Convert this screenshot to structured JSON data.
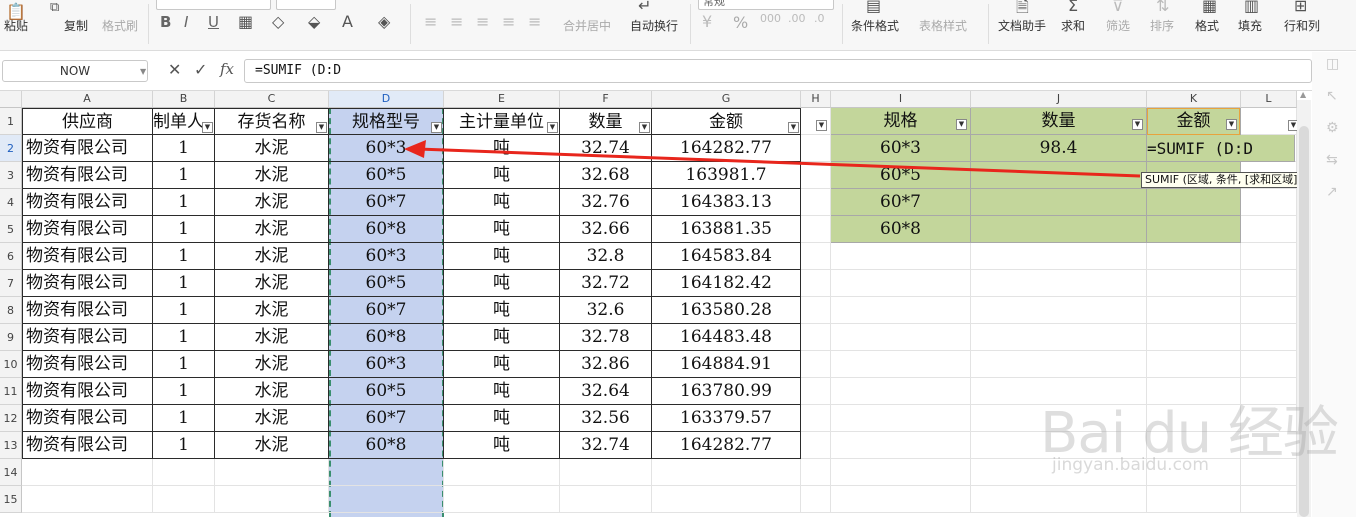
{
  "ribbon": {
    "paste": "粘贴",
    "copy": "复制",
    "format_painter": "格式刷",
    "bold": "B",
    "italic": "I",
    "underline": "U",
    "merge_center": "合并居中",
    "wrap_text": "自动换行",
    "number_format": "常规",
    "percent": "%",
    "conditional_format": "条件格式",
    "table_style": "表格样式",
    "doc_assistant": "文档助手",
    "sum": "求和",
    "filter": "筛选",
    "sort": "排序",
    "format": "格式",
    "fill": "填充",
    "row_col": "行和列",
    "accent": "#e8a33d"
  },
  "formula_bar": {
    "name_box": "NOW",
    "cancel": "✕",
    "confirm": "✓",
    "fx": "fx",
    "formula": "=SUMIF (D:D"
  },
  "columns": [
    "A",
    "B",
    "C",
    "D",
    "E",
    "F",
    "G",
    "H",
    "I",
    "J",
    "K",
    "L"
  ],
  "rows": [
    "1",
    "2",
    "3",
    "4",
    "5",
    "6",
    "7",
    "8",
    "9",
    "10",
    "11",
    "12",
    "13",
    "14",
    "15"
  ],
  "table": {
    "headers": [
      "供应商",
      "制单人",
      "存货名称",
      "规格型号",
      "主计量单位",
      "数量",
      "金额"
    ],
    "rows": [
      [
        "物资有限公司",
        "1",
        "水泥",
        "60*3",
        "吨",
        "32.74",
        "164282.77"
      ],
      [
        "物资有限公司",
        "1",
        "水泥",
        "60*5",
        "吨",
        "32.68",
        "163981.7"
      ],
      [
        "物资有限公司",
        "1",
        "水泥",
        "60*7",
        "吨",
        "32.76",
        "164383.13"
      ],
      [
        "物资有限公司",
        "1",
        "水泥",
        "60*8",
        "吨",
        "32.66",
        "163881.35"
      ],
      [
        "物资有限公司",
        "1",
        "水泥",
        "60*3",
        "吨",
        "32.8",
        "164583.84"
      ],
      [
        "物资有限公司",
        "1",
        "水泥",
        "60*5",
        "吨",
        "32.72",
        "164182.42"
      ],
      [
        "物资有限公司",
        "1",
        "水泥",
        "60*7",
        "吨",
        "32.6",
        "163580.28"
      ],
      [
        "物资有限公司",
        "1",
        "水泥",
        "60*8",
        "吨",
        "32.78",
        "164483.48"
      ],
      [
        "物资有限公司",
        "1",
        "水泥",
        "60*3",
        "吨",
        "32.86",
        "164884.91"
      ],
      [
        "物资有限公司",
        "1",
        "水泥",
        "60*5",
        "吨",
        "32.64",
        "163780.99"
      ],
      [
        "物资有限公司",
        "1",
        "水泥",
        "60*7",
        "吨",
        "32.56",
        "163379.57"
      ],
      [
        "物资有限公司",
        "1",
        "水泥",
        "60*8",
        "吨",
        "32.74",
        "164282.77"
      ]
    ]
  },
  "summary": {
    "headers": [
      "规格",
      "数量",
      "金额"
    ],
    "rows": [
      [
        "60*3",
        "98.4",
        "=SUMIF (D:D"
      ],
      [
        "60*5",
        "",
        ""
      ],
      [
        "60*7",
        "",
        ""
      ],
      [
        "60*8",
        "",
        ""
      ]
    ],
    "fill_color": "#c3d69b"
  },
  "tooltip": "SUMIF (区域, 条件, [求和区域])",
  "watermark": {
    "brand": "Bai du 经验",
    "url": "jingyan.baidu.com"
  }
}
